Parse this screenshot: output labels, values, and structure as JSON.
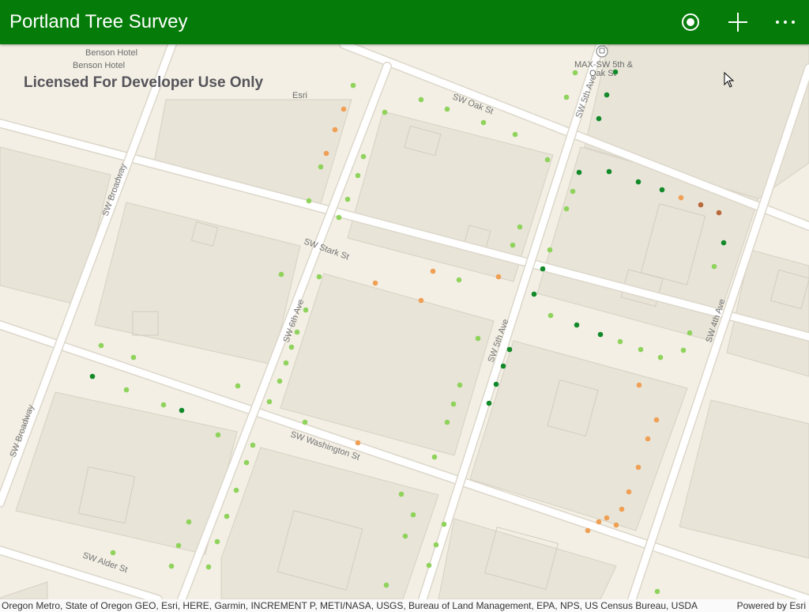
{
  "app": {
    "title": "Portland Tree Survey"
  },
  "toolbar": [
    {
      "icon": "locate-icon",
      "label": ""
    },
    {
      "icon": "add-icon",
      "label": ""
    },
    {
      "icon": "more-icon",
      "label": ""
    }
  ],
  "map": {
    "watermark": "Licensed For Developer Use Only",
    "poi": {
      "hotel_1": "Benson Hotel",
      "hotel_2": "Benson Hotel",
      "esri": "Esri",
      "max_station_1": "MAX-SW 5th &",
      "max_station_2": "Oak St"
    },
    "streets": {
      "oak": "SW Oak St",
      "stark": "SW Stark St",
      "washington": "SW Washington St",
      "alder": "SW Alder St",
      "broadway_n": "SW Broadway",
      "broadway_s": "SW Broadway",
      "sixth": "SW 6th Ave",
      "fifth_n": "SW 5th Ave",
      "fifth_s": "SW 5th Ave",
      "fourth": "SW 4th Ave"
    },
    "colors": {
      "light_green": "#8fd35c",
      "dark_green": "#138a2a",
      "orange": "#f0a055",
      "brown": "#b8693a"
    }
  },
  "attribution": {
    "text": "Oregon Metro, State of Oregon GEO, Esri, HERE, Garmin, INCREMENT P, METI/NASA, USGS, Bureau of Land Management, EPA, NPS, US Census Bureau, USDA",
    "powered": "Powered by Esri"
  }
}
